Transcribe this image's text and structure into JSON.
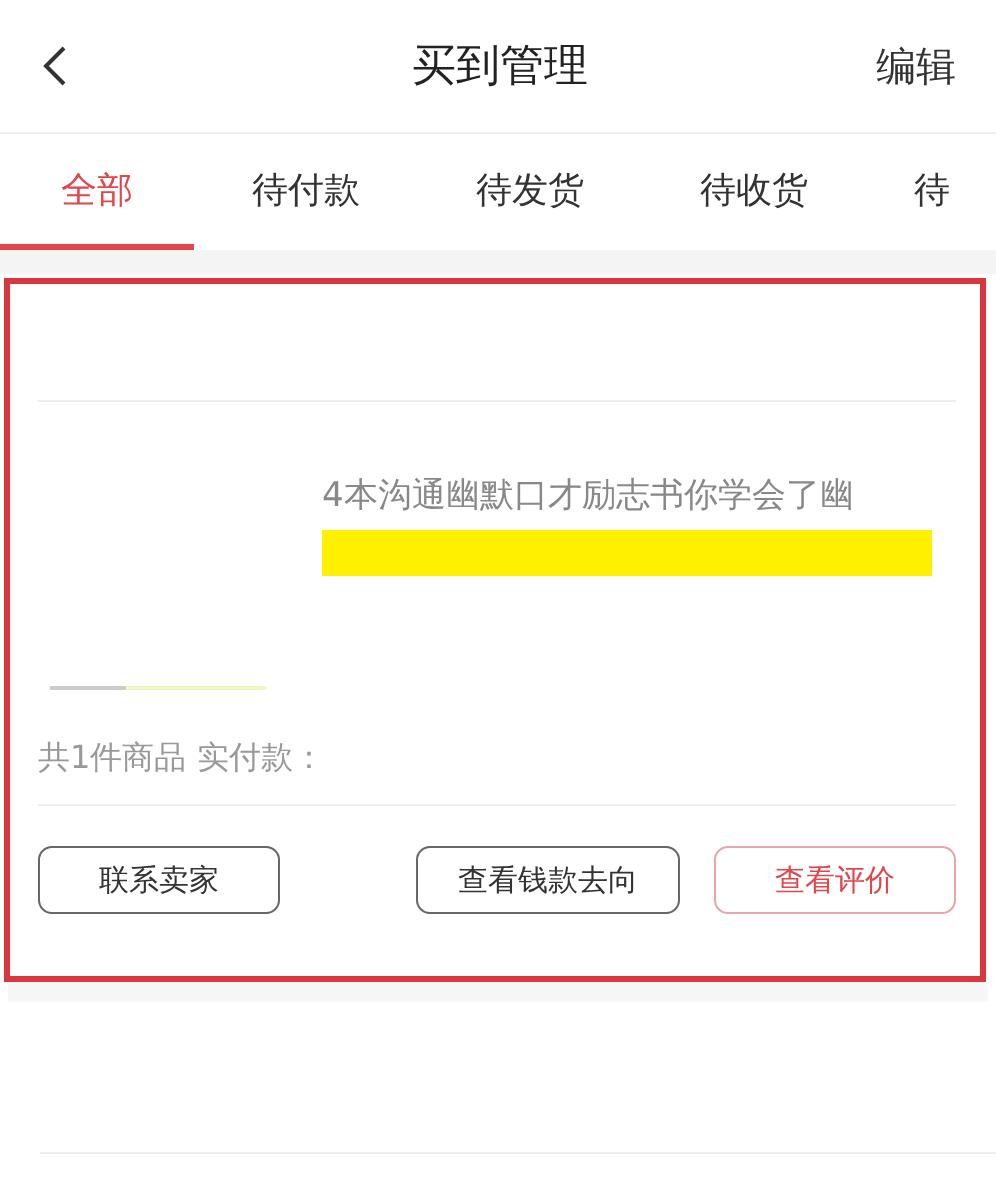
{
  "header": {
    "title": "买到管理",
    "action": "编辑"
  },
  "tabs": [
    {
      "label": "全部",
      "selected": true
    },
    {
      "label": "待付款",
      "selected": false
    },
    {
      "label": "待发货",
      "selected": false
    },
    {
      "label": "待收货",
      "selected": false
    },
    {
      "label": "待",
      "selected": false
    }
  ],
  "order": {
    "highlighted": true,
    "product_title": "4本沟通幽默口才励志书你学会了幽",
    "summary": "共1件商品 实付款：",
    "buttons": [
      {
        "label": "联系卖家",
        "kind": "plain"
      },
      {
        "label": "查看钱款去向",
        "kind": "plain"
      },
      {
        "label": "查看评价",
        "kind": "accent"
      }
    ]
  }
}
